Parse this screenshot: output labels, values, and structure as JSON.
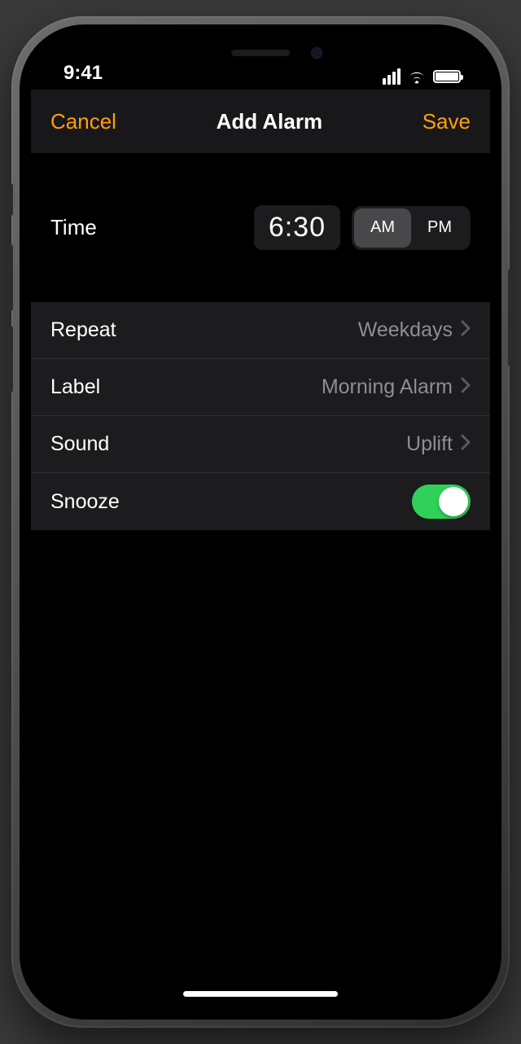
{
  "statusbar": {
    "time": "9:41"
  },
  "nav": {
    "cancel": "Cancel",
    "title": "Add Alarm",
    "save": "Save"
  },
  "time": {
    "label": "Time",
    "value": "6:30",
    "am": "AM",
    "pm": "PM",
    "selected": "AM"
  },
  "rows": {
    "repeat": {
      "label": "Repeat",
      "value": "Weekdays"
    },
    "label": {
      "label": "Label",
      "value": "Morning Alarm"
    },
    "sound": {
      "label": "Sound",
      "value": "Uplift"
    },
    "snooze": {
      "label": "Snooze",
      "on": true
    }
  },
  "colors": {
    "accent": "#ff9f0a",
    "toggleOn": "#30d158"
  }
}
